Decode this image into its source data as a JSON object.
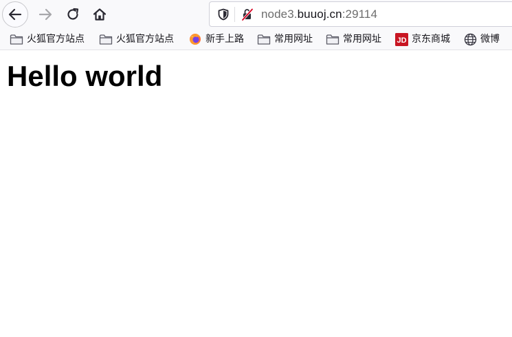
{
  "nav": {
    "back_icon": "arrow-left-icon",
    "forward_icon": "arrow-right-icon",
    "reload_icon": "reload-icon",
    "home_icon": "home-icon"
  },
  "urlbar": {
    "prefix": "node3.",
    "host": "buuoj.cn",
    "suffix": ":29114"
  },
  "bookmarks": [
    {
      "label": "火狐官方站点",
      "icon": "folder-icon"
    },
    {
      "label": "火狐官方站点",
      "icon": "folder-icon"
    },
    {
      "label": "新手上路",
      "icon": "firefox-icon"
    },
    {
      "label": "常用网址",
      "icon": "folder-icon"
    },
    {
      "label": "常用网址",
      "icon": "folder-icon"
    },
    {
      "label": "京东商城",
      "icon": "jd-icon"
    },
    {
      "label": "微博",
      "icon": "globe-icon"
    }
  ],
  "page": {
    "heading": "Hello world"
  },
  "colors": {
    "toolbar_bg": "#f9f9fb",
    "jd_red": "#c81623",
    "insecure_red": "#d70022"
  }
}
